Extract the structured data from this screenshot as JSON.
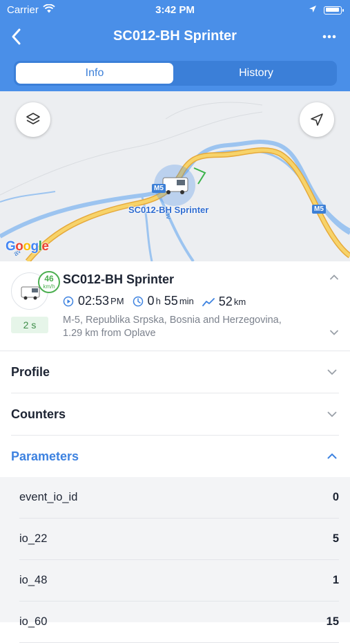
{
  "status_bar": {
    "carrier": "Carrier",
    "time": "3:42 PM"
  },
  "nav": {
    "title": "SC012-BH Sprinter",
    "more": "•••"
  },
  "tabs": [
    {
      "label": "Info",
      "active": true
    },
    {
      "label": "History",
      "active": false
    }
  ],
  "map": {
    "vehicle_label": "SC012-BH Sprinter",
    "attribution": "Google",
    "road_labels": [
      "M5",
      "M5"
    ],
    "river_label": "zav",
    "river_label_2": "av"
  },
  "summary": {
    "unit_name": "SC012-BH Sprinter",
    "speed": "46",
    "speed_unit": "km/h",
    "last_update": "2 s",
    "time_value": "02:53",
    "time_suffix": "PM",
    "duration_hours": "0",
    "duration_hours_unit": "h",
    "duration_minutes": "55",
    "duration_minutes_unit": "min",
    "distance_value": "52",
    "distance_unit": "km",
    "address_line1": "M-5, Republika Srpska, Bosnia and Herzegovina,",
    "address_line2": "1.29 km from Oplave"
  },
  "sections": [
    {
      "label": "Profile",
      "expanded": false
    },
    {
      "label": "Counters",
      "expanded": false
    },
    {
      "label": "Parameters",
      "expanded": true
    }
  ],
  "parameters": [
    {
      "key": "event_io_id",
      "value": "0"
    },
    {
      "key": "io_22",
      "value": "5"
    },
    {
      "key": "io_48",
      "value": "1"
    },
    {
      "key": "io_60",
      "value": "15"
    }
  ],
  "colors": {
    "primary": "#4a8fe8",
    "accent": "#3d82e0",
    "speed_green": "#4caf50"
  }
}
